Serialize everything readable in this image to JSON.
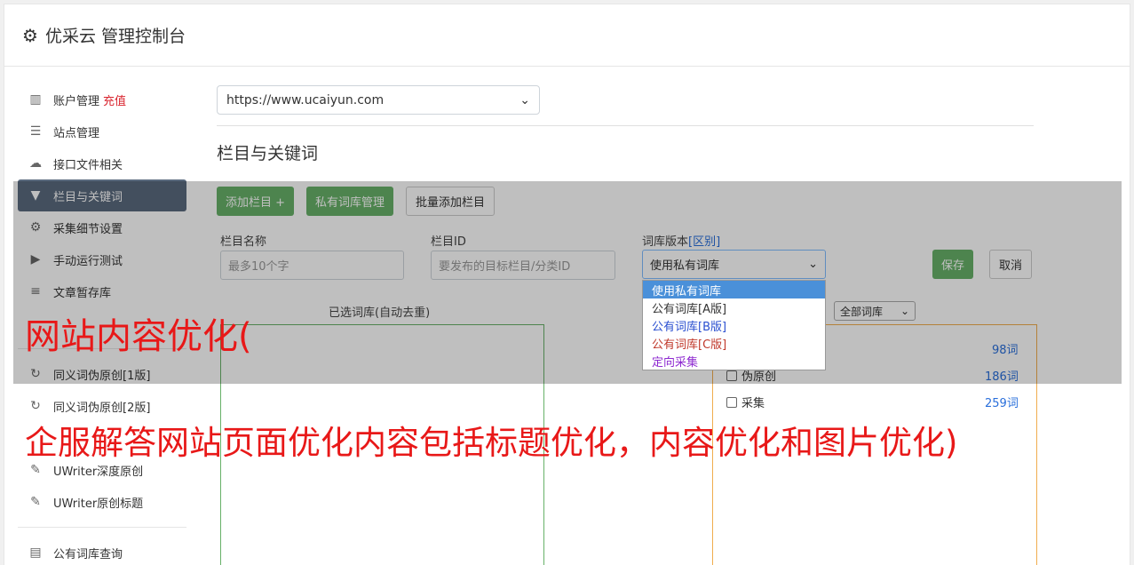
{
  "header": {
    "title": "优采云 管理控制台"
  },
  "sidebar": {
    "items": [
      {
        "icon": "bar-chart-icon",
        "label": "账户管理",
        "extra": "充值"
      },
      {
        "icon": "server-icon",
        "label": "站点管理"
      },
      {
        "icon": "cloud-upload-icon",
        "label": "接口文件相关"
      },
      {
        "icon": "filter-icon",
        "label": "栏目与关键词",
        "active": true
      },
      {
        "icon": "cogs-icon",
        "label": "采集细节设置"
      },
      {
        "icon": "play-icon",
        "label": "手动运行测试"
      },
      {
        "icon": "database-icon",
        "label": "文章暂存库"
      },
      {
        "icon": "refresh-icon",
        "label": "同义词伪原创[1版]"
      },
      {
        "icon": "refresh-icon",
        "label": "同义词伪原创[2版]"
      },
      {
        "icon": "edit-icon",
        "label": "UWriter深度原创"
      },
      {
        "icon": "edit-icon",
        "label": "UWriter原创标题"
      },
      {
        "icon": "book-icon",
        "label": "公有词库查询"
      }
    ]
  },
  "main": {
    "site_select": "https://www.ucaiyun.com",
    "section_title": "栏目与关键词",
    "buttons": {
      "add_column": "添加栏目 +",
      "private_lib": "私有词库管理",
      "batch_add": "批量添加栏目"
    },
    "fields": {
      "column_name_label": "栏目名称",
      "column_name_placeholder": "最多10个字",
      "column_id_label": "栏目ID",
      "column_id_placeholder": "要发布的目标栏目/分类ID",
      "dict_version_label": "词库版本",
      "dict_version_link": "[区别]",
      "dict_version_value": "使用私有词库"
    },
    "dropdown_options": [
      {
        "label": "使用私有词库",
        "color": "#ffffff"
      },
      {
        "label": "公有词库[A版]",
        "color": "#333333"
      },
      {
        "label": "公有词库[B版]",
        "color": "#2a4fd0"
      },
      {
        "label": "公有词库[C版]",
        "color": "#c0392b"
      },
      {
        "label": "定向采集",
        "color": "#8e2ad0"
      }
    ],
    "save": "保存",
    "cancel": "取消",
    "selected_lib_label": "已选词库(自动去重)",
    "all_libs_select": "全部词库",
    "libs": [
      {
        "name": "",
        "count": "98词"
      },
      {
        "name": "伪原创",
        "count": "186词"
      },
      {
        "name": "采集",
        "count": "259词"
      }
    ]
  },
  "overlay_text": {
    "line1": "网站内容优化(",
    "line2": "企服解答网站页面优化内容包括标题优化，内容优化和图片优化)"
  }
}
